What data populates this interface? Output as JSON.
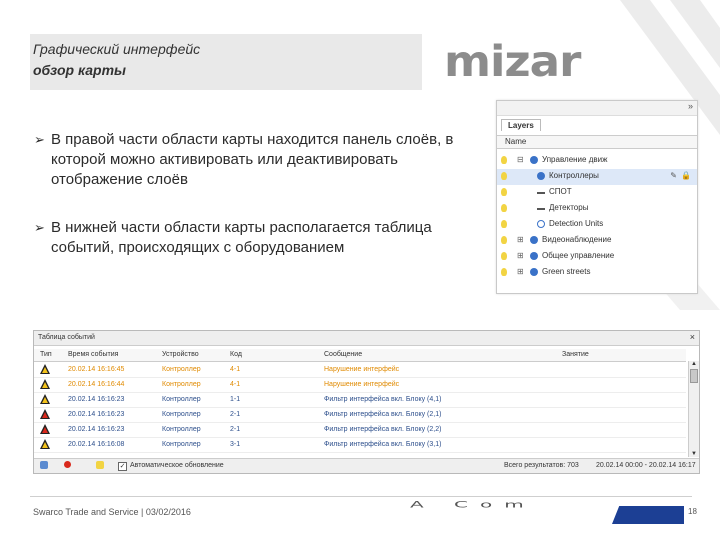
{
  "header": {
    "title_line1": "Графический интерфейс",
    "title_line2": "обзор карты",
    "logo_text": "mizar",
    "logo_color": "#1c3f94"
  },
  "bullets": [
    "В правой части области карты находится панель слоёв, в которой можно активировать или деактивировать отображение слоёв",
    "В нижней части области карты располагается таблица событий, происходящих с оборудованием"
  ],
  "layers_panel": {
    "collapse_icon": "»",
    "tab_label": "Layers",
    "column_name": "Name",
    "rows": [
      {
        "label": "Управление движ",
        "icon": "globe-icon"
      },
      {
        "label": "Контроллеры",
        "icon": "globe-icon"
      },
      {
        "label": "СПОТ",
        "icon": "line-icon"
      },
      {
        "label": "Детекторы",
        "icon": "line-icon"
      },
      {
        "label": "Detection Units",
        "icon": "detector-icon"
      },
      {
        "label": "Видеонаблюдение",
        "icon": "globe-icon"
      },
      {
        "label": "Общее управление",
        "icon": "globe-icon"
      },
      {
        "label": "Green streets",
        "icon": "globe-icon"
      }
    ]
  },
  "events_table": {
    "title": "Таблица событий",
    "close_icon": "×",
    "columns": [
      "Тип",
      "Время события",
      "Устройство",
      "Код",
      "Сообщение",
      "Занятие"
    ],
    "rows": [
      {
        "time": "20.02.14 16:16:45",
        "device": "Контроллер",
        "code": "4-1",
        "message": "Нарушение интерфейс",
        "color": "orange",
        "severity": "warning"
      },
      {
        "time": "20.02.14 16:16:44",
        "device": "Контроллер",
        "code": "4-1",
        "message": "Нарушение интерфейс",
        "color": "orange",
        "severity": "warning"
      },
      {
        "time": "20.02.14 16:16:23",
        "device": "Контроллер",
        "code": "1-1",
        "message": "Фильтр интерфейса вкл. Блоку (4,1)",
        "color": "blue",
        "severity": "warning"
      },
      {
        "time": "20.02.14 16:16:23",
        "device": "Контроллер",
        "code": "2-1",
        "message": "Фильтр интерфейса вкл. Блоку (2,1)",
        "color": "blue",
        "severity": "error"
      },
      {
        "time": "20.02.14 16:16:23",
        "device": "Контроллер",
        "code": "2-1",
        "message": "Фильтр интерфейса вкл. Блоку (2,2)",
        "color": "blue",
        "severity": "error"
      },
      {
        "time": "20.02.14 16:16:08",
        "device": "Контроллер",
        "code": "3-1",
        "message": "Фильтр интерфейса вкл. Блоку (3,1)",
        "color": "blue",
        "severity": "warning"
      }
    ],
    "footer": {
      "auto_refresh_checked": "✓",
      "auto_refresh_label": "Автоматическое обновление",
      "results_label": "Всего результатов: 703",
      "date_range": "20.02.14 00:00 - 20.02.14 16:17"
    }
  },
  "footer": {
    "company": "Swarco Trade and Service | 03/02/2016",
    "logo_text": "A Com",
    "page_number": "18"
  }
}
